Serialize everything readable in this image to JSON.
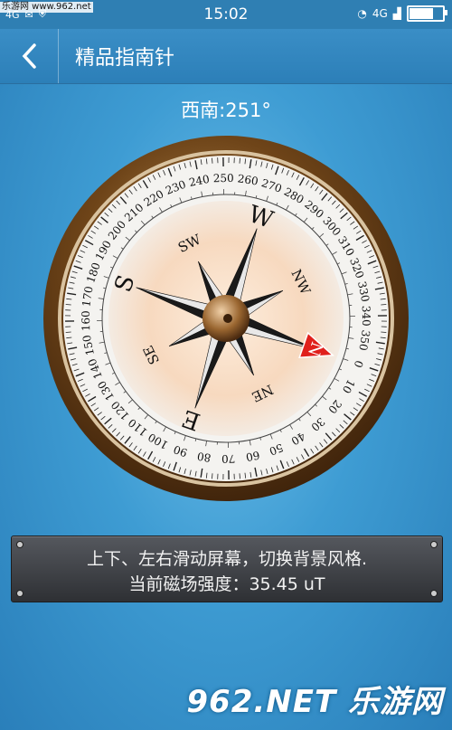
{
  "status_bar": {
    "carrier_label": "4G",
    "time": "15:02",
    "network": "4G",
    "battery_level": 0.75
  },
  "watermark_top": "乐游网 www.962.net",
  "header": {
    "back_icon": "chevron-left-icon",
    "title": "精品指南针"
  },
  "compass": {
    "heading_text": "西南:251°",
    "heading_degrees": 251,
    "cardinals": [
      "N",
      "E",
      "S",
      "W"
    ],
    "intercardinals": [
      "NE",
      "SE",
      "SW",
      "NW"
    ],
    "degree_labels": [
      "0",
      "10",
      "20",
      "30",
      "40",
      "50",
      "60",
      "70",
      "80",
      "90",
      "100",
      "110",
      "120",
      "130",
      "140",
      "150",
      "160",
      "170",
      "180",
      "190",
      "200",
      "210",
      "220",
      "230",
      "240",
      "250",
      "260",
      "270",
      "280",
      "290",
      "300",
      "310",
      "320",
      "330",
      "340",
      "350"
    ],
    "needle_color": "#e0201c"
  },
  "info_panel": {
    "line1": "上下、左右滑动屏幕，切换背景风格.",
    "line2": "当前磁场强度：35.45 uT"
  },
  "watermark_bottom": "962.NET 乐游网"
}
